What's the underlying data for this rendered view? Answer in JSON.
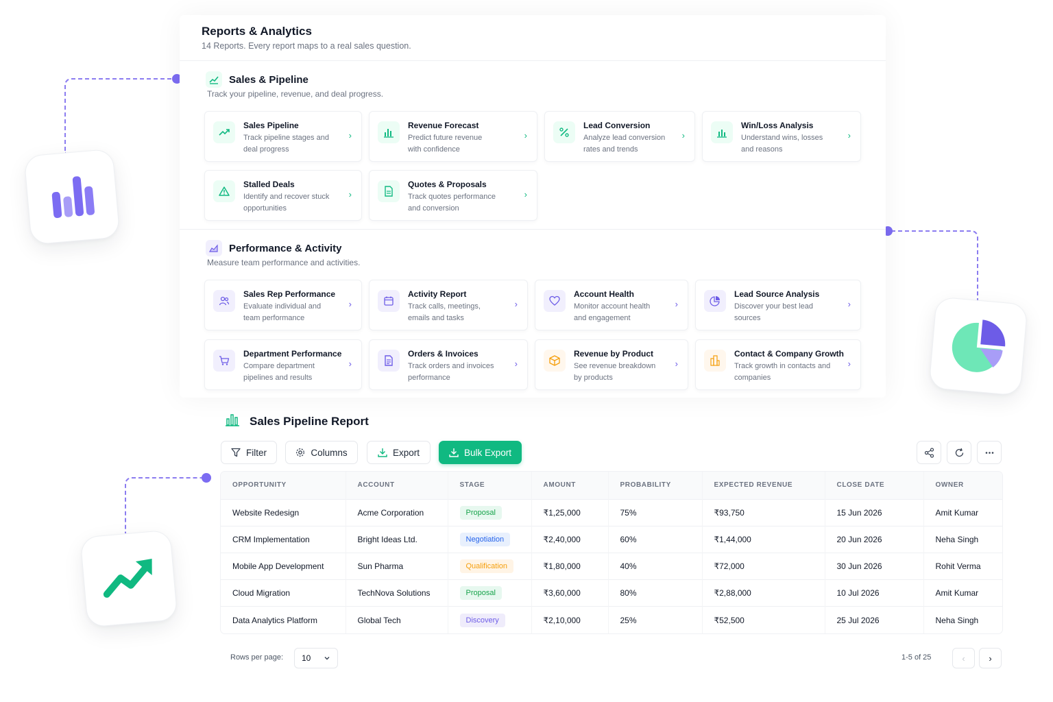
{
  "header": {
    "title": "Reports & Analytics",
    "subtitle": "14 Reports. Every report maps to a real sales question."
  },
  "sections": [
    {
      "title": "Sales & Pipeline",
      "subtitle": "Track your pipeline, revenue, and deal progress.",
      "icon": "trend-chart-icon",
      "cards": [
        {
          "title": "Sales Pipeline",
          "desc": "Track pipeline stages and deal progress",
          "icon": "trending-up-icon",
          "accent": "#10b981"
        },
        {
          "title": "Revenue Forecast",
          "desc": "Predict future revenue with confidence",
          "icon": "bar-chart-icon",
          "accent": "#10b981"
        },
        {
          "title": "Lead Conversion",
          "desc": "Analyze lead conversion rates and trends",
          "icon": "percent-icon",
          "accent": "#10b981"
        },
        {
          "title": "Win/Loss Analysis",
          "desc": "Understand wins, losses and reasons",
          "icon": "bar-chart-icon",
          "accent": "#10b981"
        },
        {
          "title": "Stalled Deals",
          "desc": "Identify and recover stuck opportunities",
          "icon": "warning-icon",
          "accent": "#10b981"
        },
        {
          "title": "Quotes & Proposals",
          "desc": "Track quotes performance and conversion",
          "icon": "document-icon",
          "accent": "#10b981"
        }
      ]
    },
    {
      "title": "Performance & Activity",
      "subtitle": "Measure team performance and activities.",
      "icon": "area-chart-icon",
      "cards": [
        {
          "title": "Sales Rep Performance",
          "desc": "Evaluate individual and team performance",
          "icon": "users-icon",
          "accent": "#6d5ce7"
        },
        {
          "title": "Activity Report",
          "desc": "Track calls, meetings, emails and tasks",
          "icon": "calendar-icon",
          "accent": "#6d5ce7"
        },
        {
          "title": "Account Health",
          "desc": "Monitor account health and engagement",
          "icon": "heart-icon",
          "accent": "#6d5ce7"
        },
        {
          "title": "Lead Source Analysis",
          "desc": "Discover your best lead sources",
          "icon": "pie-chart-icon",
          "accent": "#6d5ce7"
        },
        {
          "title": "Department Performance",
          "desc": "Compare department pipelines and results",
          "icon": "cart-icon",
          "accent": "#6d5ce7"
        },
        {
          "title": "Orders & Invoices",
          "desc": "Track orders and invoices performance",
          "icon": "invoice-icon",
          "accent": "#6d5ce7"
        },
        {
          "title": "Revenue by Product",
          "desc": "See revenue breakdown by products",
          "icon": "box-icon",
          "accent": "#f59e0b"
        },
        {
          "title": "Contact & Company Growth",
          "desc": "Track growth in contacts and companies",
          "icon": "building-icon",
          "accent": "#f59e0b"
        }
      ]
    }
  ],
  "report": {
    "title": "Sales Pipeline Report",
    "toolbar": {
      "filter": "Filter",
      "columns": "Columns",
      "export": "Export",
      "bulk_export": "Bulk Export"
    },
    "columns": [
      "OPPORTUNITY",
      "ACCOUNT",
      "STAGE",
      "AMOUNT",
      "PROBABILITY",
      "EXPECTED REVENUE",
      "CLOSE DATE",
      "OWNER"
    ],
    "rows": [
      {
        "opportunity": "Website Redesign",
        "account": "Acme Corporation",
        "stage": "Proposal",
        "amount": "₹1,25,000",
        "probability": "75%",
        "expected": "₹93,750",
        "close": "15 Jun 2026",
        "owner": "Amit Kumar"
      },
      {
        "opportunity": "CRM Implementation",
        "account": "Bright Ideas Ltd.",
        "stage": "Negotiation",
        "amount": "₹2,40,000",
        "probability": "60%",
        "expected": "₹1,44,000",
        "close": "20 Jun 2026",
        "owner": "Neha Singh"
      },
      {
        "opportunity": "Mobile App Development",
        "account": "Sun Pharma",
        "stage": "Qualification",
        "amount": "₹1,80,000",
        "probability": "40%",
        "expected": "₹72,000",
        "close": "30 Jun 2026",
        "owner": "Rohit Verma"
      },
      {
        "opportunity": "Cloud Migration",
        "account": "TechNova Solutions",
        "stage": "Proposal",
        "amount": "₹3,60,000",
        "probability": "80%",
        "expected": "₹2,88,000",
        "close": "10 Jul 2026",
        "owner": "Amit Kumar"
      },
      {
        "opportunity": "Data Analytics Platform",
        "account": "Global Tech",
        "stage": "Discovery",
        "amount": "₹2,10,000",
        "probability": "25%",
        "expected": "₹52,500",
        "close": "25 Jul 2026",
        "owner": "Neha Singh"
      }
    ],
    "pagination": {
      "rows_label": "Rows per page:",
      "rows_value": "10",
      "range": "1-5 of 25"
    }
  },
  "colors": {
    "accent_green": "#10b981",
    "accent_purple": "#6d5ce7",
    "accent_orange": "#f59e0b"
  }
}
